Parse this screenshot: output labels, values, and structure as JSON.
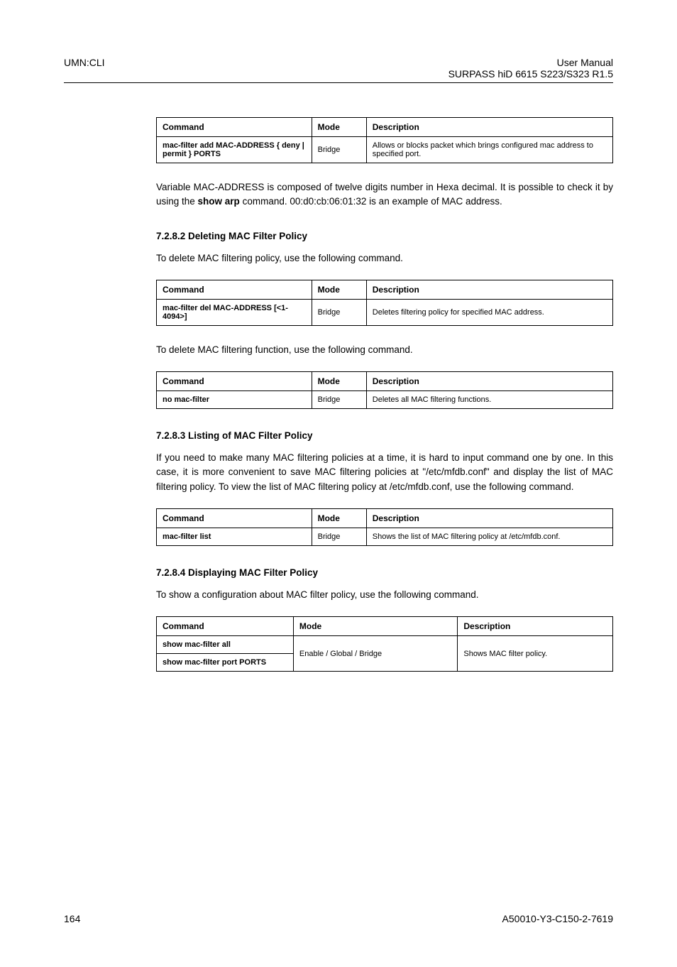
{
  "header": {
    "left": "UMN:CLI",
    "rightLine1": "User Manual",
    "rightLine2": "SURPASS hiD 6615 S223/S323 R1.5"
  },
  "footer": {
    "left": "164",
    "right": "A50010-Y3-C150-2-7619"
  },
  "table1": {
    "h1": "Command",
    "h2": "Mode",
    "h3": "Description",
    "cmd": "mac-filter add MAC-ADDRESS { deny | permit } PORTS",
    "mode": "Bridge",
    "desc": "Allows or blocks packet which brings configured mac address to specified port."
  },
  "para1a": "Variable MAC-ADDRESS is composed of twelve digits number in Hexa decimal. It is possible to check it by using the ",
  "para1b": "show arp",
  "para1c": " command. 00:d0:cb:06:01:32 is an example of MAC address.",
  "sec2": {
    "title": "7.2.8.2 Deleting MAC Filter Policy",
    "intro": "To delete MAC filtering policy, use the following command.",
    "t1": {
      "h1": "Command",
      "h2": "Mode",
      "h3": "Description",
      "cmd": "mac-filter del MAC-ADDRESS [<1-4094>]",
      "mode": "Bridge",
      "desc": "Deletes filtering policy for specified MAC address."
    },
    "intro2": "To delete MAC filtering function, use the following command.",
    "t2": {
      "h1": "Command",
      "h2": "Mode",
      "h3": "Description",
      "cmd": "no mac-filter",
      "mode": "Bridge",
      "desc": "Deletes all MAC filtering functions."
    }
  },
  "sec3": {
    "title": "7.2.8.3 Listing of MAC Filter Policy",
    "intro": "If you need to make many MAC filtering policies at a time, it is hard to input command one by one. In this case, it is more convenient to save MAC filtering policies at \"/etc/mfdb.conf\" and display the list of MAC filtering policy. To view the list of MAC filtering policy at /etc/mfdb.conf, use the following command.",
    "t": {
      "h1": "Command",
      "h2": "Mode",
      "h3": "Description",
      "cmd": "mac-filter list",
      "mode": "Bridge",
      "desc": "Shows the list of MAC filtering policy at /etc/mfdb.conf."
    }
  },
  "sec4": {
    "title": "7.2.8.4 Displaying MAC Filter Policy",
    "intro": "To show a configuration about MAC filter policy, use the following command.",
    "t": {
      "h1": "Command",
      "h2": "Mode",
      "h3": "Description",
      "cmd1": "show mac-filter all",
      "cmd2": "show mac-filter port PORTS",
      "mode": "Enable / Global / Bridge",
      "desc": "Shows MAC filter policy."
    }
  }
}
